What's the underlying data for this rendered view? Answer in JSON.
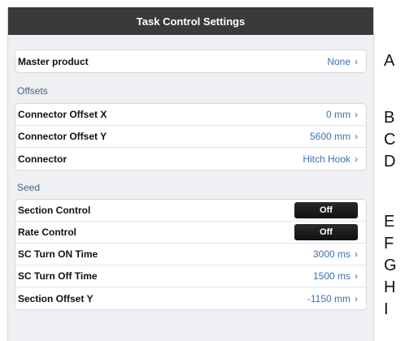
{
  "title": "Task Control Settings",
  "master": {
    "label": "Master product",
    "value": "None"
  },
  "offsets_header": "Offsets",
  "offsets": [
    {
      "label": "Connector Offset X",
      "value": "0 mm"
    },
    {
      "label": "Connector Offset Y",
      "value": "5600 mm"
    },
    {
      "label": "Connector",
      "value": "Hitch Hook"
    }
  ],
  "seed_header": "Seed",
  "seed": {
    "section_control": {
      "label": "Section Control",
      "value": "Off"
    },
    "rate_control": {
      "label": "Rate Control",
      "value": "Off"
    },
    "sc_on": {
      "label": "SC Turn ON Time",
      "value": "3000 ms"
    },
    "sc_off": {
      "label": "SC Turn Off Time",
      "value": "1500 ms"
    },
    "section_offset_y": {
      "label": "Section Offset Y",
      "value": "-1150 mm"
    }
  },
  "markers": [
    "A",
    "B",
    "C",
    "D",
    "E",
    "F",
    "G",
    "H",
    "I"
  ],
  "colors": {
    "titlebar": "#3a3a3a",
    "value_text": "#3b6fb3",
    "background": "#efeff4"
  }
}
